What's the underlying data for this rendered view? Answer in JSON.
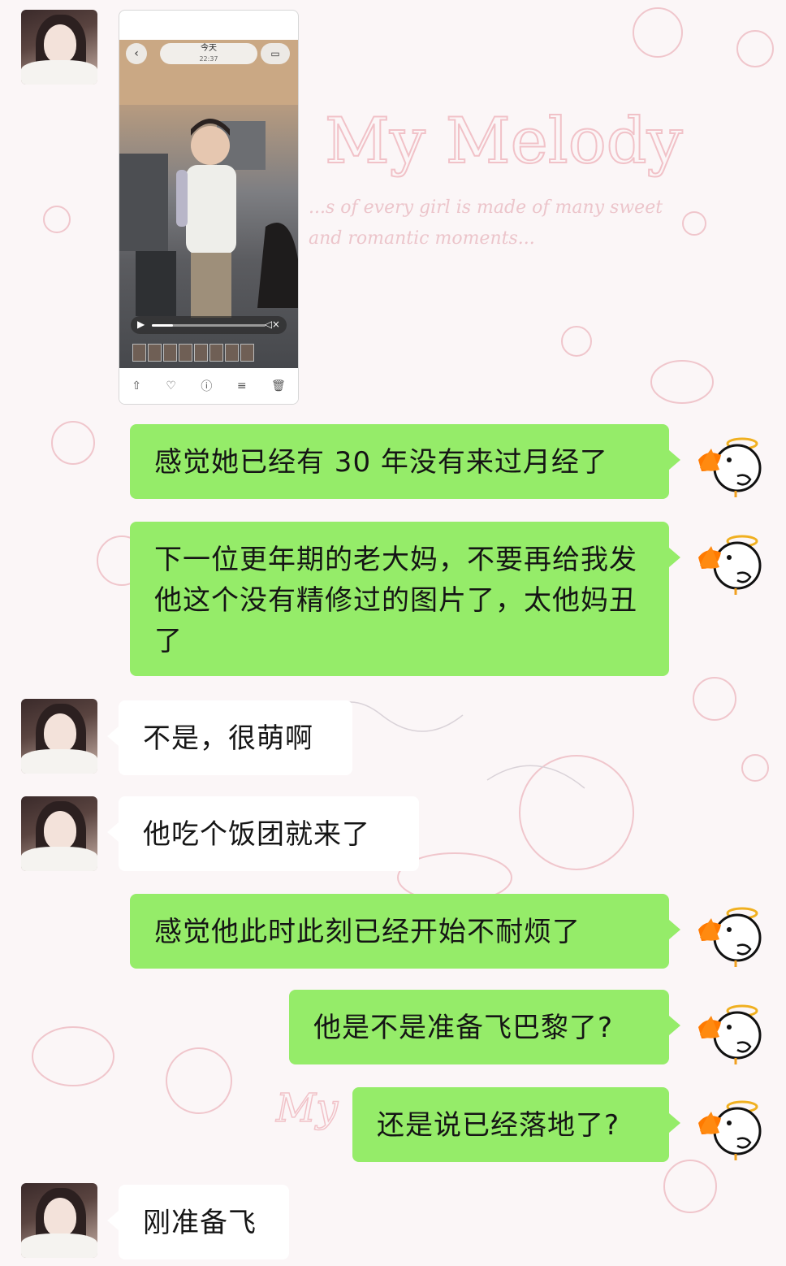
{
  "video": {
    "date_label": "今天",
    "time_label": "22:37",
    "back_icon": "chevron-left-icon",
    "camera_icon": "video-camera-icon",
    "toolbar_icons": [
      "share-icon",
      "heart-icon",
      "info-icon",
      "sliders-icon",
      "trash-icon"
    ]
  },
  "messages": [
    {
      "side": "right",
      "text": "感觉她已经有 30 年没有来过月经了"
    },
    {
      "side": "right",
      "text": "下一位更年期的老大妈，不要再给我发他这个没有精修过的图片了，太他妈丑了"
    },
    {
      "side": "left",
      "text": "不是，很萌啊"
    },
    {
      "side": "left",
      "text": "他吃个饭团就来了"
    },
    {
      "side": "right",
      "text": "感觉他此时此刻已经开始不耐烦了"
    },
    {
      "side": "right",
      "text": "他是不是准备飞巴黎了?"
    },
    {
      "side": "right",
      "text": "还是说已经落地了?"
    },
    {
      "side": "left",
      "text": "刚准备飞"
    }
  ],
  "colors": {
    "right_bubble": "#95ec69",
    "left_bubble": "#ffffff",
    "background": "#fbf6f7"
  },
  "background_watermark": {
    "title": "My Melody",
    "subtitle_line1": "...s of every girl is made of many sweet",
    "subtitle_line2": "and romantic moments..."
  }
}
